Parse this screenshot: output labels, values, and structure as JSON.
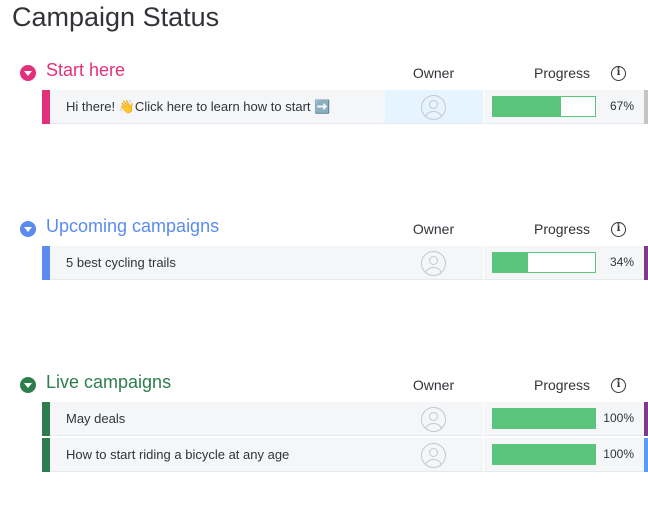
{
  "page": {
    "title": "Campaign Status"
  },
  "colors": {
    "pink": "#e2307b",
    "blue": "#5c8bf0",
    "green": "#2e7d4f",
    "progress": "#5ac47d",
    "gray_end": "#c4c4c4",
    "purple_end": "#7e3b8a",
    "blue_end": "#579bfc"
  },
  "groups": [
    {
      "title": "Start here",
      "color": "#e2307b",
      "owner_label": "Owner",
      "progress_label": "Progress",
      "info_icon": "info-icon",
      "rows": [
        {
          "name": "Hi there! 👋Click here to learn how to start ➡️",
          "owner": "",
          "progress": 0.67,
          "progress_text": "67%",
          "end_color": "#c4c4c4",
          "owner_highlight": true
        }
      ]
    },
    {
      "title": "Upcoming campaigns",
      "color": "#5c8bf0",
      "owner_label": "Owner",
      "progress_label": "Progress",
      "info_icon": "info-icon",
      "rows": [
        {
          "name": "5 best cycling trails",
          "owner": "",
          "progress": 0.34,
          "progress_text": "34%",
          "end_color": "#7e3b8a",
          "owner_highlight": false
        }
      ]
    },
    {
      "title": "Live campaigns",
      "color": "#2e7d4f",
      "owner_label": "Owner",
      "progress_label": "Progress",
      "info_icon": "info-icon",
      "rows": [
        {
          "name": "May deals",
          "owner": "",
          "progress": 1.0,
          "progress_text": "100%",
          "end_color": "#7e3b8a",
          "owner_highlight": false
        },
        {
          "name": "How to start riding a bicycle at any age",
          "owner": "",
          "progress": 1.0,
          "progress_text": "100%",
          "end_color": "#579bfc",
          "owner_highlight": false
        }
      ]
    }
  ]
}
